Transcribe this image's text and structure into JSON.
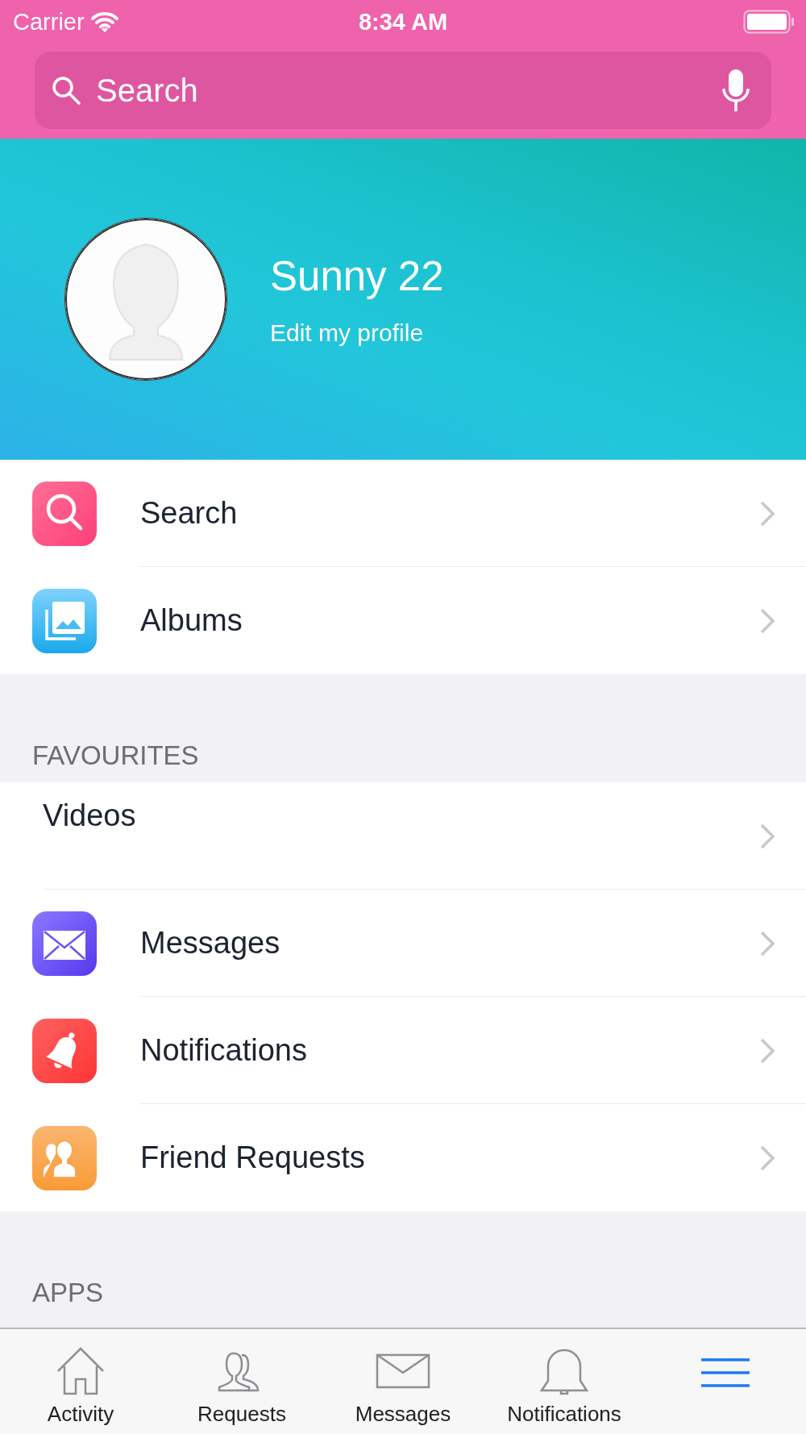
{
  "status_bar": {
    "carrier": "Carrier",
    "time": "8:34 AM"
  },
  "search": {
    "placeholder": "Search"
  },
  "profile": {
    "name": "Sunny 22",
    "edit_link": "Edit my profile"
  },
  "sections": [
    {
      "items": [
        {
          "kind": "search",
          "label": "Search"
        },
        {
          "kind": "albums",
          "label": "Albums"
        }
      ]
    },
    {
      "header": "FAVOURITES",
      "items": [
        {
          "kind": "plain",
          "label": "Videos"
        },
        {
          "kind": "messages",
          "label": "Messages"
        },
        {
          "kind": "notifications",
          "label": "Notifications"
        },
        {
          "kind": "friends",
          "label": "Friend Requests"
        }
      ]
    },
    {
      "header": "APPS"
    }
  ],
  "tabs": [
    {
      "kind": "activity",
      "label": "Activity",
      "selected": false
    },
    {
      "kind": "requests",
      "label": "Requests",
      "selected": false
    },
    {
      "kind": "messages",
      "label": "Messages",
      "selected": false
    },
    {
      "kind": "notifications",
      "label": "Notifications",
      "selected": false
    },
    {
      "kind": "menu",
      "selected": true
    }
  ]
}
